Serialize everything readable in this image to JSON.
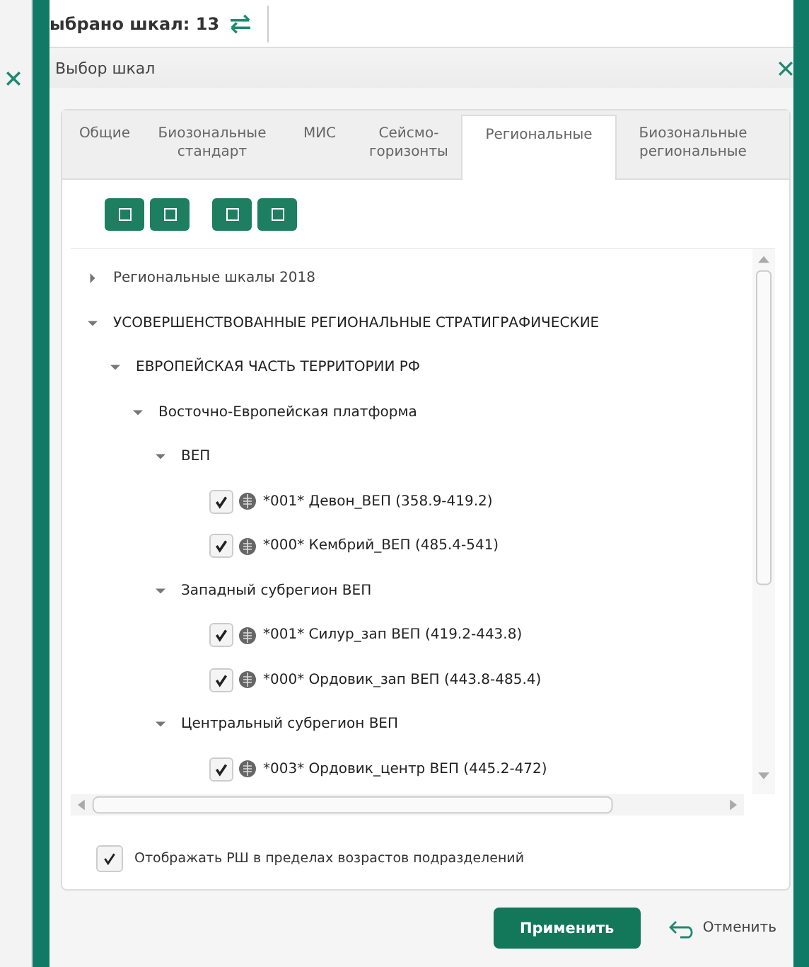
{
  "top_bar": {
    "selected_count": "ыбрано шкал: 13"
  },
  "dialog": {
    "title": "Выбор шкал",
    "tabs": [
      {
        "label": "Общие",
        "selected": false
      },
      {
        "label": "Биозональные стандарт",
        "selected": false
      },
      {
        "label": "МИС",
        "selected": false
      },
      {
        "label": "Сейсмо- горизонты",
        "selected": false
      },
      {
        "label": "Региональные",
        "selected": true
      },
      {
        "label": "Биозональные региональные",
        "selected": false
      }
    ],
    "tree": [
      {
        "kind": "group",
        "label": "Региональные шкалы 2018",
        "expanded": false
      },
      {
        "kind": "group",
        "label": "УСОВЕРШЕНСТВОВАННЫЕ РЕГИОНАЛЬНЫЕ СТРАТИГРАФИЧЕСКИЕ",
        "expanded": true,
        "children": [
          {
            "kind": "group",
            "label": "ЕВРОПЕЙСКАЯ ЧАСТЬ ТЕРРИТОРИИ РФ",
            "expanded": true,
            "children": [
              {
                "kind": "group",
                "label": "Восточно-Европейская платформа",
                "expanded": true,
                "children": [
                  {
                    "kind": "group",
                    "label": "ВЕП",
                    "expanded": true,
                    "children": [
                      {
                        "kind": "scale",
                        "label": "*001* Девон_ВЕП (358.9-419.2)",
                        "checked": true
                      },
                      {
                        "kind": "scale",
                        "label": "*000* Кембрий_ВЕП (485.4-541)",
                        "checked": true
                      }
                    ]
                  },
                  {
                    "kind": "group",
                    "label": "Западный субрегион ВЕП",
                    "expanded": true,
                    "children": [
                      {
                        "kind": "scale",
                        "label": "*001* Силур_зап ВЕП (419.2-443.8)",
                        "checked": true
                      },
                      {
                        "kind": "scale",
                        "label": "*000* Ордовик_зап ВЕП (443.8-485.4)",
                        "checked": true
                      }
                    ]
                  },
                  {
                    "kind": "group",
                    "label": "Центральный субрегион ВЕП",
                    "expanded": true,
                    "children": [
                      {
                        "kind": "scale",
                        "label": "*003* Ордовик_центр ВЕП (445.2-472)",
                        "checked": true
                      }
                    ]
                  }
                ]
              }
            ]
          }
        ]
      }
    ],
    "show_option": {
      "label": "Отображать РШ в пределах возрастов подразделений",
      "checked": true
    },
    "apply_button": "Применить",
    "cancel_button": "Отменить"
  }
}
